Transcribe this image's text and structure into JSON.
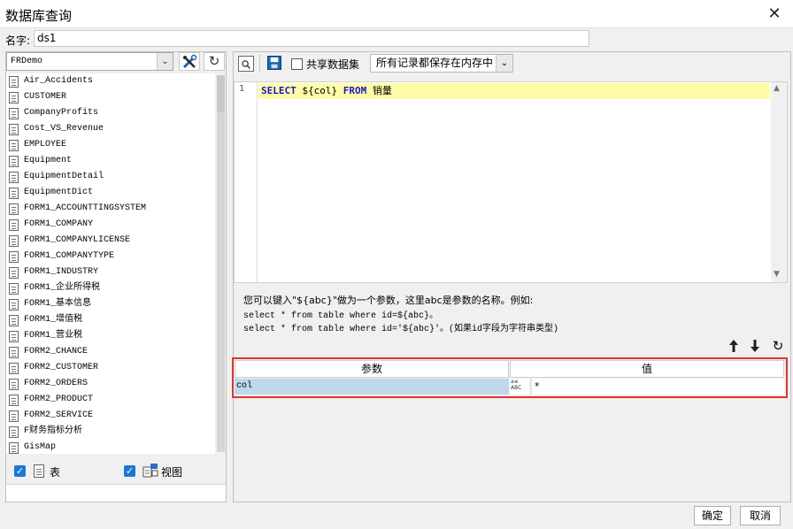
{
  "window": {
    "title": "数据库查询",
    "close_glyph": "✕"
  },
  "name_row": {
    "label": "名字:",
    "value": "ds1"
  },
  "left": {
    "datasource": "FRDemo",
    "dropdown_glyph": "⌄",
    "refresh_glyph": "↻",
    "tables": [
      "Air_Accidents",
      "CUSTOMER",
      "CompanyProfits",
      "Cost_VS_Revenue",
      "EMPLOYEE",
      "Equipment",
      "EquipmentDetail",
      "EquipmentDict",
      "FORM1_ACCOUNTTINGSYSTEM",
      "FORM1_COMPANY",
      "FORM1_COMPANYLICENSE",
      "FORM1_COMPANYTYPE",
      "FORM1_INDUSTRY",
      "FORM1_企业所得税",
      "FORM1_基本信息",
      "FORM1_增值税",
      "FORM1_营业税",
      "FORM2_CHANCE",
      "FORM2_CUSTOMER",
      "FORM2_ORDERS",
      "FORM2_PRODUCT",
      "FORM2_SERVICE",
      "F财务指标分析",
      "GisMap"
    ],
    "show_tables_label": "表",
    "show_views_label": "视图",
    "check_glyph": "✓"
  },
  "right": {
    "shared_label": "共享数据集",
    "cache_mode": "所有记录都保存在内存中",
    "dropdown_glyph": "⌄",
    "editor": {
      "line_number": "1",
      "kw_select": "SELECT",
      "param_expr": " ${col} ",
      "kw_from": "FROM",
      "table_name": " 销量",
      "scroll_up": "▲",
      "scroll_down": "▼"
    },
    "hints": [
      "您可以键入\"${abc}\"做为一个参数，这里abc是参数的名称。例如:",
      "select * from table where id=${abc}。",
      "select * from table where id='${abc}'。(如果id字段为字符串类型)"
    ],
    "param_toolbar": {
      "up_glyph": "🡑",
      "down_glyph": "🡓",
      "refresh_glyph": "↻"
    },
    "params": {
      "headers": [
        "参数",
        "值"
      ],
      "rows": [
        {
          "name": "col",
          "type_icon": "a≤\nABC",
          "value": "*"
        }
      ]
    }
  },
  "footer": {
    "ok": "确定",
    "cancel": "取消"
  }
}
